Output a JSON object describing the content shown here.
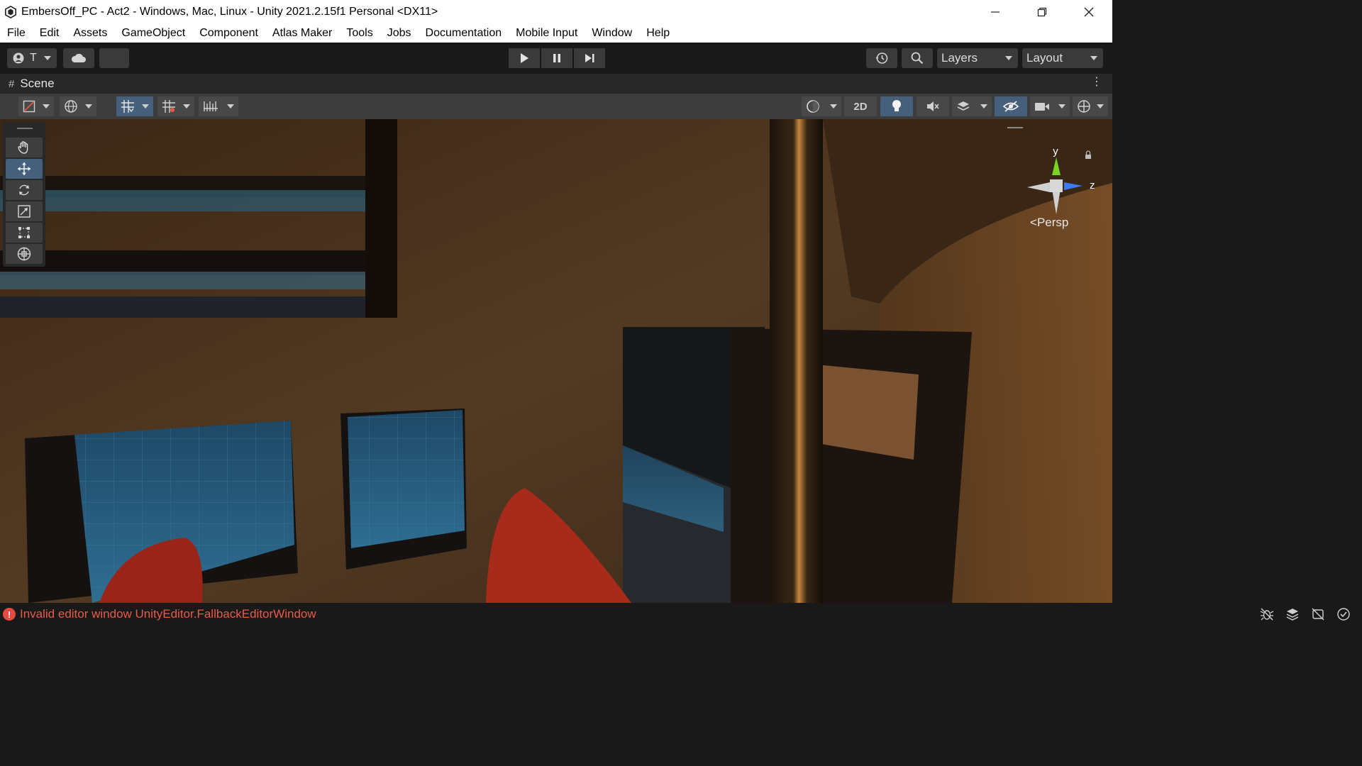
{
  "window": {
    "title": "EmbersOff_PC - Act2 - Windows, Mac, Linux - Unity 2021.2.15f1 Personal <DX11>",
    "controls": [
      "minimize-icon",
      "restore-icon",
      "close-icon"
    ]
  },
  "menu": {
    "items": [
      "File",
      "Edit",
      "Assets",
      "GameObject",
      "Component",
      "Atlas Maker",
      "Tools",
      "Jobs",
      "Documentation",
      "Mobile Input",
      "Window",
      "Help"
    ]
  },
  "toolbar": {
    "account_label": "T",
    "cloud_icon": "cloud-icon",
    "play_controls": [
      "play-icon",
      "pause-icon",
      "step-icon"
    ],
    "history_icon": "history-icon",
    "search_icon": "search-icon",
    "layers_label": "Layers",
    "layout_label": "Layout"
  },
  "scene": {
    "tab_label": "Scene",
    "mode_2d_label": "2D",
    "projection_label": "Persp",
    "gizmo_axes": {
      "y": "y",
      "z": "z"
    }
  },
  "tools": [
    "hand-tool",
    "move-tool",
    "rotate-tool",
    "scale-tool",
    "rect-tool",
    "transform-tool"
  ],
  "active_tool": "move-tool",
  "status": {
    "error_message": "Invalid editor window UnityEditor.FallbackEditorWindow",
    "icons": [
      "bug-icon",
      "layers-icon",
      "no-debug-icon",
      "check-icon"
    ]
  },
  "colors": {
    "accent": "#46607c",
    "error": "#ea5a48",
    "gizmo_y": "#7bd321",
    "gizmo_z": "#3d7bf2"
  }
}
